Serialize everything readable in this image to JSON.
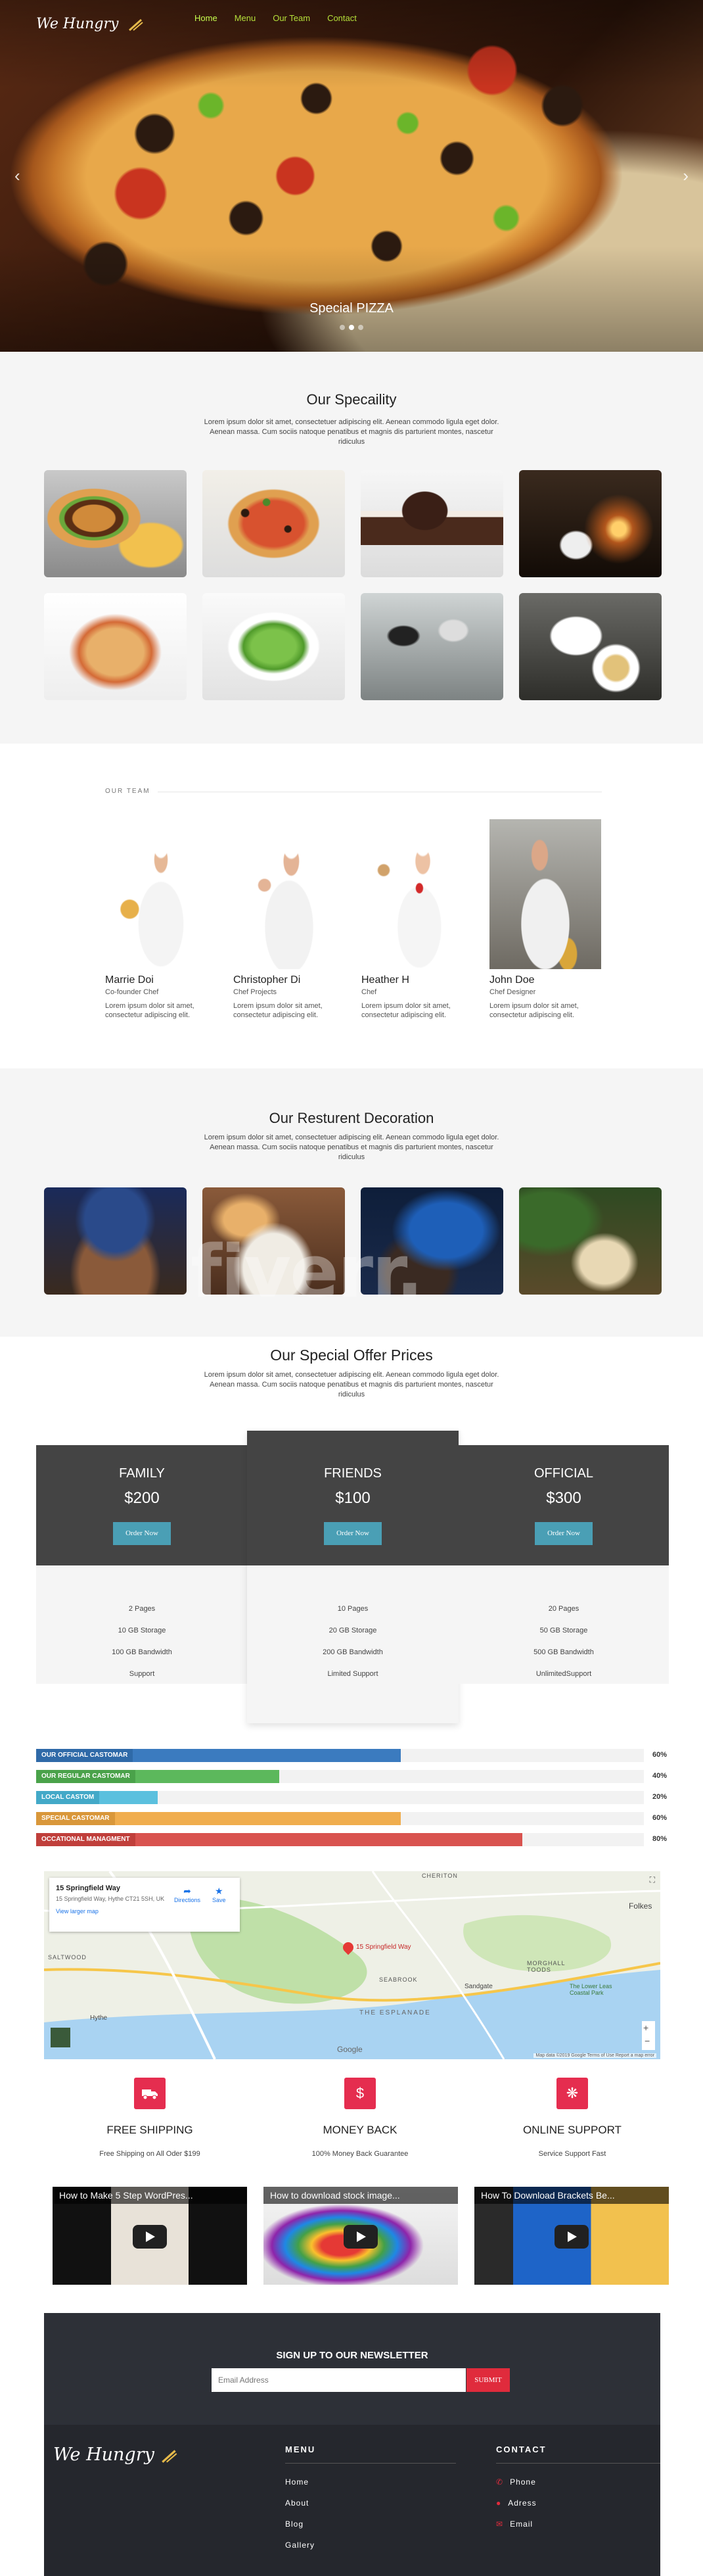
{
  "nav": {
    "logo": "We Hungry",
    "items": [
      "Home",
      "Menu",
      "Our Team",
      "Contact"
    ]
  },
  "hero": {
    "caption": "Special PIZZA",
    "prev_icon": "chevron-left-icon",
    "next_icon": "chevron-right-icon",
    "slide_count": 3,
    "active_slide": 2
  },
  "speciality": {
    "title": "Our Specaility",
    "description": "Lorem ipsum dolor sit amet, consectetuer adipiscing elit. Aenean commodo ligula eget dolor. Aenean massa. Cum sociis natoque penatibus et magnis dis parturient montes, nascetur ridiculus"
  },
  "team": {
    "label": "OUR TEAM",
    "members": [
      {
        "name": "Marrie Doi",
        "role": "Co-founder Chef",
        "bio": "Lorem ipsum dolor sit amet, consectetur adipiscing elit."
      },
      {
        "name": "Christopher Di",
        "role": "Chef Projects",
        "bio": "Lorem ipsum dolor sit amet, consectetur adipiscing elit."
      },
      {
        "name": "Heather H",
        "role": "Chef",
        "bio": "Lorem ipsum dolor sit amet, consectetur adipiscing elit."
      },
      {
        "name": "John Doe",
        "role": "Chef Designer",
        "bio": "Lorem ipsum dolor sit amet, consectetur adipiscing elit."
      }
    ]
  },
  "decoration": {
    "title": "Our Resturent Decoration",
    "description": "Lorem ipsum dolor sit amet, consectetuer adipiscing elit. Aenean commodo ligula eget dolor. Aenean massa. Cum sociis natoque penatibus et magnis dis parturient montes, nascetur ridiculus"
  },
  "pricing": {
    "title": "Our Special Offer Prices",
    "description": "Lorem ipsum dolor sit amet, consectetuer adipiscing elit. Aenean commodo ligula eget dolor. Aenean massa. Cum sociis natoque penatibus et magnis dis parturient montes, nascetur ridiculus",
    "button_label": "Order Now",
    "plans": [
      {
        "name": "FAMILY",
        "price": "$200",
        "features": [
          "2 Pages",
          "10 GB Storage",
          "100 GB Bandwidth",
          "Support"
        ]
      },
      {
        "name": "FRIENDS",
        "price": "$100",
        "features": [
          "10 Pages",
          "20 GB Storage",
          "200 GB Bandwidth",
          "Limited Support"
        ]
      },
      {
        "name": "OFFICIAL",
        "price": "$300",
        "features": [
          "20 Pages",
          "50 GB Storage",
          "500 GB Bandwidth",
          "UnlimitedSupport"
        ]
      }
    ]
  },
  "stats": [
    {
      "label": "OUR OFFICIAL CASTOMAR",
      "value": "60%",
      "fraction": 0.6,
      "color": "#3b7bbf",
      "label_bg": "#2f6aa8"
    },
    {
      "label": "OUR REGULAR CASTOMAR",
      "value": "40%",
      "fraction": 0.4,
      "color": "#5cb85c",
      "label_bg": "#4aa24a"
    },
    {
      "label": "LOCAL CASTOM",
      "value": "20%",
      "fraction": 0.2,
      "color": "#5bc0de",
      "label_bg": "#43a9c8"
    },
    {
      "label": "SPECIAL CASTOMAR",
      "value": "60%",
      "fraction": 0.6,
      "color": "#f0ad4e",
      "label_bg": "#d9973a"
    },
    {
      "label": "OCCATIONAL MANAGMENT",
      "value": "80%",
      "fraction": 0.8,
      "color": "#d9534f",
      "label_bg": "#c03f3b"
    }
  ],
  "map": {
    "place_title": "15 Springfield Way",
    "place_address": "15 Springfield Way, Hythe CT21 5SH, UK",
    "directions_label": "Directions",
    "save_label": "Save",
    "larger_map_label": "View larger map",
    "pin_label": "15 Springfield Way",
    "labels": [
      "CHERITON",
      "SALTWOOD",
      "SEABROOK",
      "Sandgate",
      "MORGHALL TOODS",
      "Hythe",
      "Folkes",
      "The Lower Leas Coastal Park",
      "THE ESPLANADE"
    ],
    "footer_text": "Map data ©2019 Google   Terms of Use   Report a map error",
    "google_label": "Google"
  },
  "features": [
    {
      "icon": "truck-icon",
      "title": "FREE SHIPPING",
      "description": "Free Shipping on All Oder $199"
    },
    {
      "icon": "dollar-icon",
      "title": "MONEY BACK",
      "description": "100% Money Back Guarantee"
    },
    {
      "icon": "support-icon",
      "title": "ONLINE SUPPORT",
      "description": "Service Support Fast"
    }
  ],
  "videos": [
    {
      "title": "How to Make 5 Step WordPres..."
    },
    {
      "title": "How to download stock image..."
    },
    {
      "title": "How To Download Brackets Be..."
    }
  ],
  "newsletter": {
    "title": "SIGN UP TO OUR NEWSLETTER",
    "placeholder": "Email Address",
    "button": "SUBMIT"
  },
  "footer": {
    "logo": "We Hungry",
    "menu_title": "MENU",
    "menu_items": [
      "Home",
      "About",
      "Blog",
      "Gallery"
    ],
    "contact_title": "CONTACT",
    "contact_items": [
      {
        "icon": "phone-icon",
        "label": "Phone"
      },
      {
        "icon": "map-marker-icon",
        "label": "Adress"
      },
      {
        "icon": "envelope-icon",
        "label": "Email"
      }
    ]
  },
  "watermark": "fiverr",
  "colors": {
    "nav_link": "#b5e03a",
    "button": "#4a9fb5",
    "accent_red": "#e52d4f",
    "dark_footer": "#25272d"
  }
}
